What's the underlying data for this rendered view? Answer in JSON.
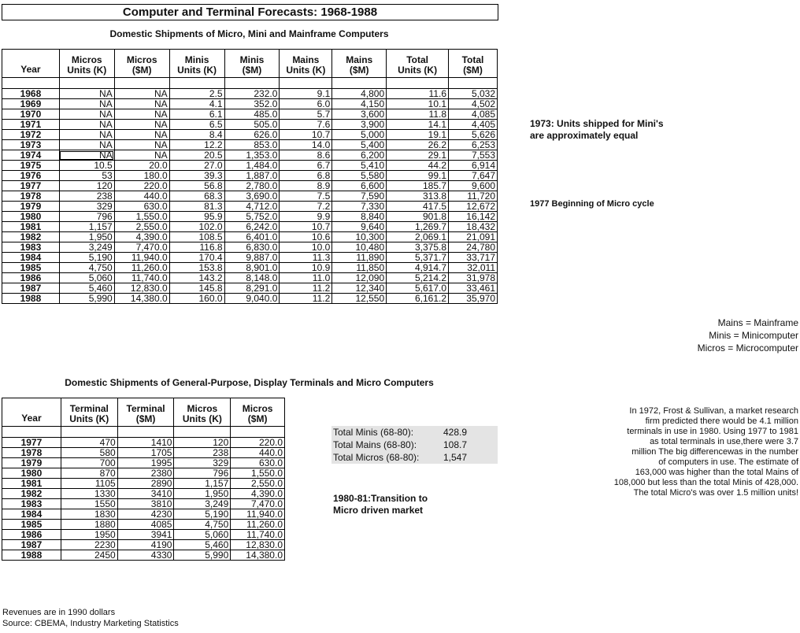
{
  "title": "Computer and Terminal Forecasts: 1968-1988",
  "table1": {
    "title": "Domestic Shipments of Micro, Mini and Mainframe Computers",
    "headers": [
      [
        "Year"
      ],
      [
        "Micros",
        "Units (K)"
      ],
      [
        "Micros",
        "($M)"
      ],
      [
        "Minis",
        "Units (K)"
      ],
      [
        "Minis",
        "($M)"
      ],
      [
        "Mains",
        "Units (K)"
      ],
      [
        "Mains",
        "($M)"
      ],
      [
        "Total",
        "Units (K)"
      ],
      [
        "Total",
        "($M)"
      ]
    ],
    "rows": [
      [
        "1968",
        "NA",
        "NA",
        "2.5",
        "232.0",
        "9.1",
        "4,800",
        "11.6",
        "5,032"
      ],
      [
        "1969",
        "NA",
        "NA",
        "4.1",
        "352.0",
        "6.0",
        "4,150",
        "10.1",
        "4,502"
      ],
      [
        "1970",
        "NA",
        "NA",
        "6.1",
        "485.0",
        "5.7",
        "3,600",
        "11.8",
        "4,085"
      ],
      [
        "1971",
        "NA",
        "NA",
        "6.5",
        "505.0",
        "7.6",
        "3,900",
        "14.1",
        "4,405"
      ],
      [
        "1972",
        "NA",
        "NA",
        "8.4",
        "626.0",
        "10.7",
        "5,000",
        "19.1",
        "5,626"
      ],
      [
        "1973",
        "NA",
        "NA",
        "12.2",
        "853.0",
        "14.0",
        "5,400",
        "26.2",
        "6,253"
      ],
      [
        "1974",
        "NA",
        "NA",
        "20.5",
        "1,353.0",
        "8.6",
        "6,200",
        "29.1",
        "7,553"
      ],
      [
        "1975",
        "10.5",
        "20.0",
        "27.0",
        "1,484.0",
        "6.7",
        "5,410",
        "44.2",
        "6,914"
      ],
      [
        "1976",
        "53",
        "180.0",
        "39.3",
        "1,887.0",
        "6.8",
        "5,580",
        "99.1",
        "7,647"
      ],
      [
        "1977",
        "120",
        "220.0",
        "56.8",
        "2,780.0",
        "8.9",
        "6,600",
        "185.7",
        "9,600"
      ],
      [
        "1978",
        "238",
        "440.0",
        "68.3",
        "3,690.0",
        "7.5",
        "7,590",
        "313.8",
        "11,720"
      ],
      [
        "1979",
        "329",
        "630.0",
        "81.3",
        "4,712.0",
        "7.2",
        "7,330",
        "417.5",
        "12,672"
      ],
      [
        "1980",
        "796",
        "1,550.0",
        "95.9",
        "5,752.0",
        "9.9",
        "8,840",
        "901.8",
        "16,142"
      ],
      [
        "1981",
        "1,157",
        "2,550.0",
        "102.0",
        "6,242.0",
        "10.7",
        "9,640",
        "1,269.7",
        "18,432"
      ],
      [
        "1982",
        "1,950",
        "4,390.0",
        "108.5",
        "6,401.0",
        "10.6",
        "10,300",
        "2,069.1",
        "21,091"
      ],
      [
        "1983",
        "3,249",
        "7,470.0",
        "116.8",
        "6,830.0",
        "10.0",
        "10,480",
        "3,375.8",
        "24,780"
      ],
      [
        "1984",
        "5,190",
        "11,940.0",
        "170.4",
        "9,887.0",
        "11.3",
        "11,890",
        "5,371.7",
        "33,717"
      ],
      [
        "1985",
        "4,750",
        "11,260.0",
        "153.8",
        "8,901.0",
        "10.9",
        "11,850",
        "4,914.7",
        "32,011"
      ],
      [
        "1986",
        "5,060",
        "11,740.0",
        "143.2",
        "8,148.0",
        "11.0",
        "12,090",
        "5,214.2",
        "31,978"
      ],
      [
        "1987",
        "5,460",
        "12,830.0",
        "145.8",
        "8,291.0",
        "11.2",
        "12,340",
        "5,617.0",
        "33,461"
      ],
      [
        "1988",
        "5,990",
        "14,380.0",
        "160.0",
        "9,040.0",
        "11.2",
        "12,550",
        "6,161.2",
        "35,970"
      ]
    ]
  },
  "table2": {
    "title": "Domestic Shipments of General-Purpose, Display Terminals and Micro Computers",
    "headers": [
      [
        "Year"
      ],
      [
        "Terminal",
        "Units (K)"
      ],
      [
        "Terminal",
        "($M)"
      ],
      [
        "Micros",
        "Units (K)"
      ],
      [
        "Micros",
        "($M)"
      ]
    ],
    "rows": [
      [
        "1977",
        "470",
        "1410",
        "120",
        "220.0"
      ],
      [
        "1978",
        "580",
        "1705",
        "238",
        "440.0"
      ],
      [
        "1979",
        "700",
        "1995",
        "329",
        "630.0"
      ],
      [
        "1980",
        "870",
        "2380",
        "796",
        "1,550.0"
      ],
      [
        "1981",
        "1105",
        "2890",
        "1,157",
        "2,550.0"
      ],
      [
        "1982",
        "1330",
        "3410",
        "1,950",
        "4,390.0"
      ],
      [
        "1983",
        "1550",
        "3810",
        "3,249",
        "7,470.0"
      ],
      [
        "1984",
        "1830",
        "4230",
        "5,190",
        "11,940.0"
      ],
      [
        "1985",
        "1880",
        "4085",
        "4,750",
        "11,260.0"
      ],
      [
        "1986",
        "1950",
        "3941",
        "5,060",
        "11,740.0"
      ],
      [
        "1987",
        "2230",
        "4190",
        "5,460",
        "12,830.0"
      ],
      [
        "1988",
        "2450",
        "4330",
        "5,990",
        "14,380.0"
      ]
    ]
  },
  "notes": {
    "note_1973": [
      "1973: Units shipped for Mini's",
      "are approximately equal"
    ],
    "note_1977": "1977 Beginning of Micro cycle",
    "legend": [
      "Mains = Mainframe",
      "Minis = Minicomputer",
      "Micros = Microcomputer"
    ],
    "transition": [
      "1980-81:Transition to",
      "Micro driven market"
    ],
    "frost": [
      "In 1972, Frost & Sullivan, a market research",
      "firm predicted there would be 4.1 million",
      "terminals in use in 1980. Using 1977 to 1981",
      "as total terminals in use,there were 3.7",
      "million The big differencewas in the number",
      "of computers in use. The estimate of",
      "163,000 was higher than the total Mains of",
      "108,000 but less than the total Minis of 428,000.",
      "The total Micro's was over 1.5 million units!"
    ],
    "footer": [
      "Revenues are in 1990 dollars",
      "Source: CBEMA, Industry Marketing Statistics"
    ]
  },
  "totals": [
    {
      "label": "Total Minis (68-80):",
      "value": "428.9"
    },
    {
      "label": "Total Mains (68-80):",
      "value": "108.7"
    },
    {
      "label": "Total Micros (68-80):",
      "value": "1,547"
    }
  ]
}
